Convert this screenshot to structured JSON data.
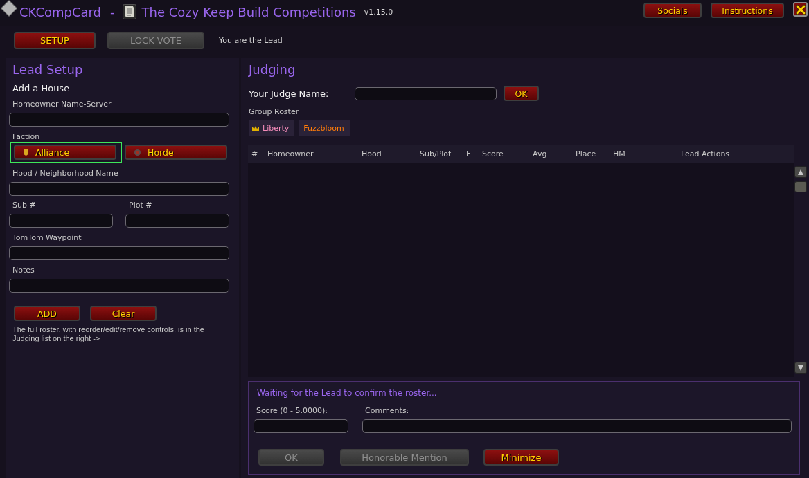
{
  "window": {
    "app_name": "CKCompCard",
    "separator": "-",
    "title": "The Cozy Keep Build Competitions",
    "version": "v1.15.0"
  },
  "header_buttons": [
    {
      "label": "Socials"
    },
    {
      "label": "Instructions"
    }
  ],
  "toolbar": {
    "buttons": [
      {
        "label": "SETUP",
        "disabled": false
      },
      {
        "label": "LOCK VOTE",
        "disabled": true
      }
    ],
    "status": "You are the Lead"
  },
  "lead_setup": {
    "title": "Lead Setup",
    "section": "Add a House",
    "rows": [
      {
        "kind": "field",
        "label": "Homeowner Name-Server"
      },
      {
        "kind": "choice",
        "label": "Faction",
        "options": [
          {
            "label": "Alliance",
            "kind": "alliance",
            "selected": true
          },
          {
            "label": "Horde",
            "kind": "horde",
            "selected": false
          }
        ]
      },
      {
        "kind": "field",
        "label": "Hood / Neighborhood Name"
      },
      {
        "kind": "pair",
        "fields": [
          {
            "label": "Sub #"
          },
          {
            "label": "Plot #"
          }
        ]
      },
      {
        "kind": "field",
        "label": "TomTom Waypoint"
      },
      {
        "kind": "field",
        "label": "Notes"
      }
    ],
    "buttons": [
      {
        "label": "ADD"
      },
      {
        "label": "Clear"
      }
    ],
    "hint": "The full roster, with reorder/edit/remove controls, is in the Judging list on the right ->"
  },
  "judging": {
    "title": "Judging",
    "judge_name": {
      "label": "Your Judge Name:",
      "button": "OK"
    },
    "roster": {
      "label": "Group Roster",
      "members": [
        {
          "name": "Liberty",
          "color": "#f48cba",
          "leader": true
        },
        {
          "name": "Fuzzbloom",
          "color": "#ff7c0a",
          "leader": false
        }
      ]
    },
    "table": {
      "columns": [
        "#",
        "Homeowner",
        "Hood",
        "Sub/Plot",
        "F",
        "Score",
        "Avg",
        "Place",
        "HM",
        "Lead Actions"
      ]
    },
    "vote_panel": {
      "status": "Waiting for the Lead to confirm the roster...",
      "score_label": "Score (0 - 5.0000):",
      "comments_label": "Comments:",
      "buttons": [
        {
          "label": "OK",
          "disabled": true
        },
        {
          "label": "Honorable Mention",
          "disabled": true
        },
        {
          "label": "Minimize",
          "disabled": false
        }
      ]
    }
  }
}
